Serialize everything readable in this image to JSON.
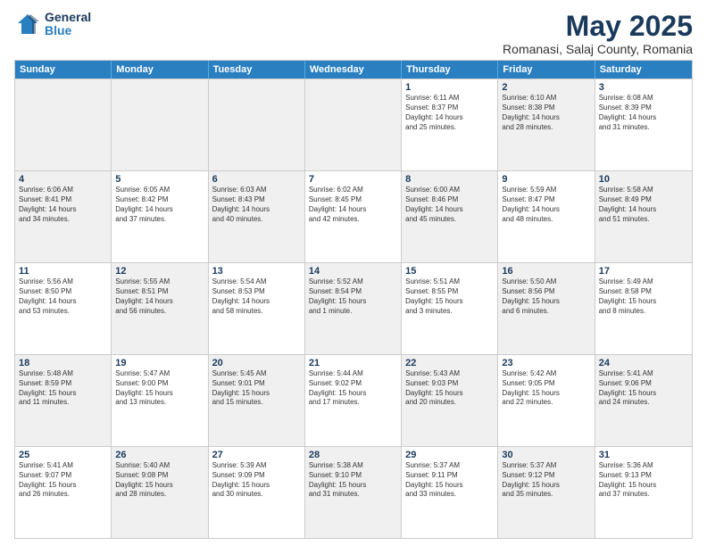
{
  "logo": {
    "general": "General",
    "blue": "Blue"
  },
  "header": {
    "month": "May 2025",
    "location": "Romanasi, Salaj County, Romania"
  },
  "weekdays": [
    "Sunday",
    "Monday",
    "Tuesday",
    "Wednesday",
    "Thursday",
    "Friday",
    "Saturday"
  ],
  "rows": [
    [
      {
        "day": "",
        "info": "",
        "shaded": true
      },
      {
        "day": "",
        "info": "",
        "shaded": true
      },
      {
        "day": "",
        "info": "",
        "shaded": true
      },
      {
        "day": "",
        "info": "",
        "shaded": true
      },
      {
        "day": "1",
        "info": "Sunrise: 6:11 AM\nSunset: 8:37 PM\nDaylight: 14 hours\nand 25 minutes."
      },
      {
        "day": "2",
        "info": "Sunrise: 6:10 AM\nSunset: 8:38 PM\nDaylight: 14 hours\nand 28 minutes.",
        "shaded": true
      },
      {
        "day": "3",
        "info": "Sunrise: 6:08 AM\nSunset: 8:39 PM\nDaylight: 14 hours\nand 31 minutes."
      }
    ],
    [
      {
        "day": "4",
        "info": "Sunrise: 6:06 AM\nSunset: 8:41 PM\nDaylight: 14 hours\nand 34 minutes.",
        "shaded": true
      },
      {
        "day": "5",
        "info": "Sunrise: 6:05 AM\nSunset: 8:42 PM\nDaylight: 14 hours\nand 37 minutes."
      },
      {
        "day": "6",
        "info": "Sunrise: 6:03 AM\nSunset: 8:43 PM\nDaylight: 14 hours\nand 40 minutes.",
        "shaded": true
      },
      {
        "day": "7",
        "info": "Sunrise: 6:02 AM\nSunset: 8:45 PM\nDaylight: 14 hours\nand 42 minutes."
      },
      {
        "day": "8",
        "info": "Sunrise: 6:00 AM\nSunset: 8:46 PM\nDaylight: 14 hours\nand 45 minutes.",
        "shaded": true
      },
      {
        "day": "9",
        "info": "Sunrise: 5:59 AM\nSunset: 8:47 PM\nDaylight: 14 hours\nand 48 minutes."
      },
      {
        "day": "10",
        "info": "Sunrise: 5:58 AM\nSunset: 8:49 PM\nDaylight: 14 hours\nand 51 minutes.",
        "shaded": true
      }
    ],
    [
      {
        "day": "11",
        "info": "Sunrise: 5:56 AM\nSunset: 8:50 PM\nDaylight: 14 hours\nand 53 minutes."
      },
      {
        "day": "12",
        "info": "Sunrise: 5:55 AM\nSunset: 8:51 PM\nDaylight: 14 hours\nand 56 minutes.",
        "shaded": true
      },
      {
        "day": "13",
        "info": "Sunrise: 5:54 AM\nSunset: 8:53 PM\nDaylight: 14 hours\nand 58 minutes."
      },
      {
        "day": "14",
        "info": "Sunrise: 5:52 AM\nSunset: 8:54 PM\nDaylight: 15 hours\nand 1 minute.",
        "shaded": true
      },
      {
        "day": "15",
        "info": "Sunrise: 5:51 AM\nSunset: 8:55 PM\nDaylight: 15 hours\nand 3 minutes."
      },
      {
        "day": "16",
        "info": "Sunrise: 5:50 AM\nSunset: 8:56 PM\nDaylight: 15 hours\nand 6 minutes.",
        "shaded": true
      },
      {
        "day": "17",
        "info": "Sunrise: 5:49 AM\nSunset: 8:58 PM\nDaylight: 15 hours\nand 8 minutes."
      }
    ],
    [
      {
        "day": "18",
        "info": "Sunrise: 5:48 AM\nSunset: 8:59 PM\nDaylight: 15 hours\nand 11 minutes.",
        "shaded": true
      },
      {
        "day": "19",
        "info": "Sunrise: 5:47 AM\nSunset: 9:00 PM\nDaylight: 15 hours\nand 13 minutes."
      },
      {
        "day": "20",
        "info": "Sunrise: 5:45 AM\nSunset: 9:01 PM\nDaylight: 15 hours\nand 15 minutes.",
        "shaded": true
      },
      {
        "day": "21",
        "info": "Sunrise: 5:44 AM\nSunset: 9:02 PM\nDaylight: 15 hours\nand 17 minutes."
      },
      {
        "day": "22",
        "info": "Sunrise: 5:43 AM\nSunset: 9:03 PM\nDaylight: 15 hours\nand 20 minutes.",
        "shaded": true
      },
      {
        "day": "23",
        "info": "Sunrise: 5:42 AM\nSunset: 9:05 PM\nDaylight: 15 hours\nand 22 minutes."
      },
      {
        "day": "24",
        "info": "Sunrise: 5:41 AM\nSunset: 9:06 PM\nDaylight: 15 hours\nand 24 minutes.",
        "shaded": true
      }
    ],
    [
      {
        "day": "25",
        "info": "Sunrise: 5:41 AM\nSunset: 9:07 PM\nDaylight: 15 hours\nand 26 minutes."
      },
      {
        "day": "26",
        "info": "Sunrise: 5:40 AM\nSunset: 9:08 PM\nDaylight: 15 hours\nand 28 minutes.",
        "shaded": true
      },
      {
        "day": "27",
        "info": "Sunrise: 5:39 AM\nSunset: 9:09 PM\nDaylight: 15 hours\nand 30 minutes."
      },
      {
        "day": "28",
        "info": "Sunrise: 5:38 AM\nSunset: 9:10 PM\nDaylight: 15 hours\nand 31 minutes.",
        "shaded": true
      },
      {
        "day": "29",
        "info": "Sunrise: 5:37 AM\nSunset: 9:11 PM\nDaylight: 15 hours\nand 33 minutes."
      },
      {
        "day": "30",
        "info": "Sunrise: 5:37 AM\nSunset: 9:12 PM\nDaylight: 15 hours\nand 35 minutes.",
        "shaded": true
      },
      {
        "day": "31",
        "info": "Sunrise: 5:36 AM\nSunset: 9:13 PM\nDaylight: 15 hours\nand 37 minutes."
      }
    ]
  ]
}
